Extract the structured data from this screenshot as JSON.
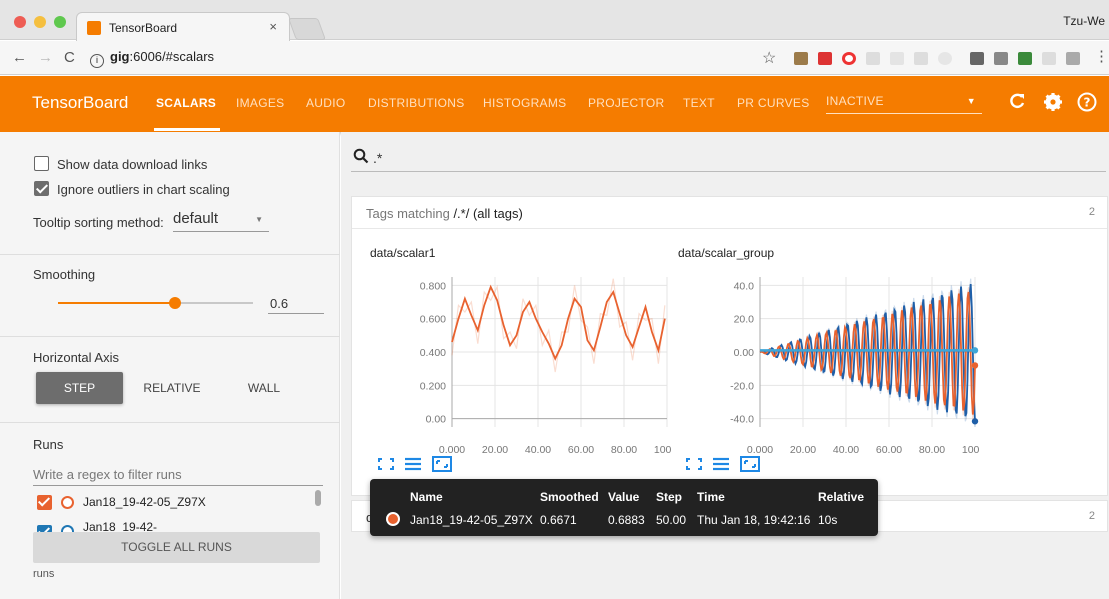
{
  "browser": {
    "tab_title": "TensorBoard",
    "tab_close": "×",
    "url_host": "gig",
    "url_rest": ":6006/#scalars",
    "user_name": "Tzu-We"
  },
  "toolbar": {
    "brand": "TensorBoard",
    "tabs": [
      "SCALARS",
      "IMAGES",
      "AUDIO",
      "DISTRIBUTIONS",
      "HISTOGRAMS",
      "PROJECTOR",
      "TEXT",
      "PR CURVES"
    ],
    "active_tab": "SCALARS",
    "inactive_dropdown": "INACTIVE",
    "accent": "#f57c00"
  },
  "sidebar": {
    "show_download_links": {
      "label": "Show data download links",
      "checked": false
    },
    "ignore_outliers": {
      "label": "Ignore outliers in chart scaling",
      "checked": true
    },
    "tooltip_sorting": {
      "label": "Tooltip sorting method:",
      "value": "default"
    },
    "smoothing": {
      "label": "Smoothing",
      "value": "0.6",
      "level": 0.6
    },
    "horizontal_axis": {
      "label": "Horizontal Axis",
      "options": [
        "STEP",
        "RELATIVE",
        "WALL"
      ],
      "selected": "STEP"
    },
    "runs": {
      "label": "Runs",
      "filter_placeholder": "Write a regex to filter runs",
      "items": [
        {
          "name": "Jan18_19-42-05_Z97X",
          "color": "#e8622f",
          "checked": true
        },
        {
          "name": "Jan18_19-42-",
          "color": "#1f77b4",
          "checked": true
        }
      ],
      "toggle_all": "TOGGLE ALL RUNS",
      "footer": "runs"
    }
  },
  "main": {
    "search_query": ".*",
    "category_prefix": "Tags matching ",
    "category_pattern": "/.*/",
    "category_suffix": " (all tags)",
    "category_count": "2",
    "second_category_prefix": "da",
    "second_category_count": "2"
  },
  "chart_data": [
    {
      "type": "line",
      "title": "data/scalar1",
      "xlabel": "",
      "ylabel": "",
      "xlim": [
        0,
        100
      ],
      "ylim": [
        -0.05,
        0.85
      ],
      "x_ticks": [
        "0.000",
        "20.00",
        "40.00",
        "60.00",
        "80.00",
        "100.0"
      ],
      "y_ticks": [
        "0.00",
        "0.200",
        "0.400",
        "0.600",
        "0.800"
      ],
      "grid": true,
      "series": [
        {
          "color": "#e8622f",
          "x": [
            0,
            3,
            6,
            9,
            12,
            15,
            18,
            21,
            24,
            27,
            30,
            33,
            36,
            39,
            42,
            45,
            48,
            51,
            54,
            57,
            60,
            63,
            66,
            69,
            72,
            75,
            78,
            81,
            84,
            87,
            90,
            93,
            96,
            99
          ],
          "values": [
            0.46,
            0.6,
            0.72,
            0.62,
            0.53,
            0.68,
            0.79,
            0.71,
            0.56,
            0.44,
            0.5,
            0.64,
            0.7,
            0.6,
            0.52,
            0.45,
            0.36,
            0.44,
            0.6,
            0.72,
            0.67,
            0.47,
            0.41,
            0.55,
            0.7,
            0.76,
            0.63,
            0.5,
            0.43,
            0.55,
            0.67,
            0.52,
            0.41,
            0.6
          ]
        }
      ]
    },
    {
      "type": "line",
      "title": "data/scalar_group",
      "xlabel": "",
      "ylabel": "",
      "xlim": [
        0,
        100
      ],
      "ylim": [
        -45,
        45
      ],
      "x_ticks": [
        "0.000",
        "20.00",
        "40.00",
        "60.00",
        "80.00",
        "100.0"
      ],
      "y_ticks": [
        "-40.0",
        "-20.0",
        "0.00",
        "20.0",
        "40.0"
      ],
      "grid": true,
      "series": [
        {
          "color": "#1f5fa8",
          "kind": "oscillation",
          "amp_end": 42,
          "period": 4.4,
          "phase": 0
        },
        {
          "color": "#e8622f",
          "kind": "oscillation",
          "amp_end": 38,
          "period": 4.4,
          "phase": 1.5
        },
        {
          "color": "#3ea6d8",
          "kind": "flat",
          "value": 1
        }
      ]
    }
  ],
  "tooltip": {
    "headers": [
      "Name",
      "Smoothed",
      "Value",
      "Step",
      "Time",
      "Relative"
    ],
    "row": {
      "name": "Jan18_19-42-05_Z97X",
      "smoothed": "0.6671",
      "value": "0.6883",
      "step": "50.00",
      "time": "Thu Jan 18, 19:42:16",
      "relative": "10s"
    },
    "dot_color": "#e8622f"
  }
}
